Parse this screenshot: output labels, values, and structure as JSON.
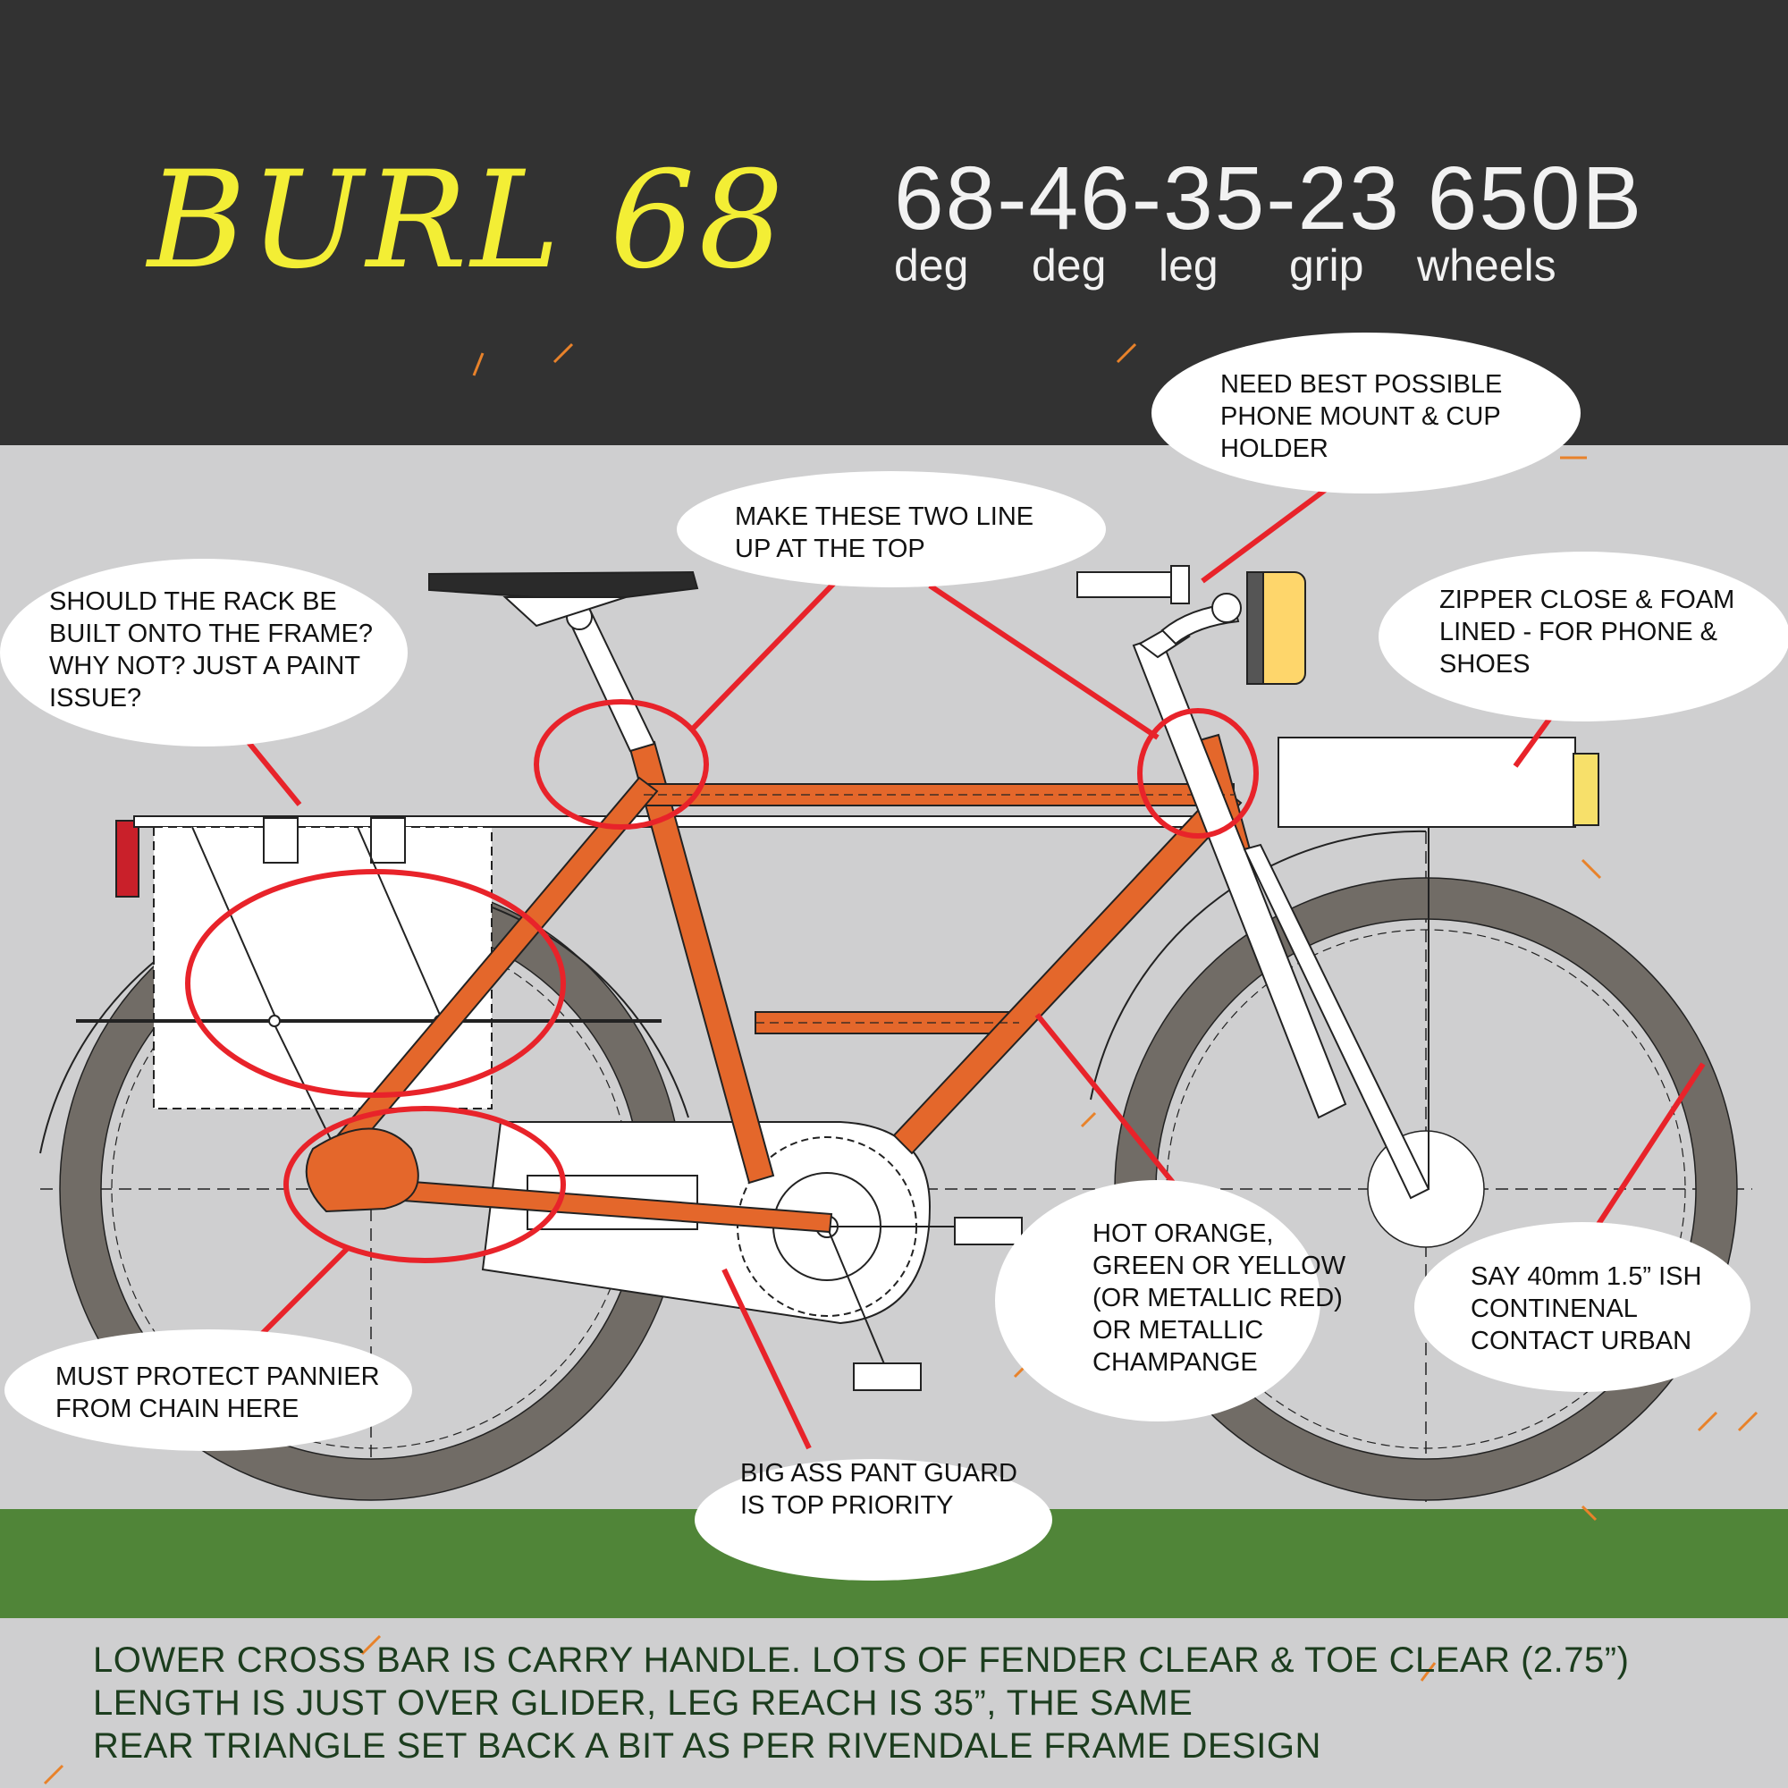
{
  "header": {
    "title": "BURL 68",
    "spec": "68-46-35-23 650B",
    "spec_labels": [
      "deg",
      "deg",
      "leg",
      "grip",
      "wheels"
    ]
  },
  "callouts": {
    "phone_mount": "NEED BEST POSSIBLE\nPHONE MOUNT & CUP\nHOLDER",
    "line_up": "MAKE THESE TWO LINE\nUP AT THE TOP",
    "rack": "SHOULD THE RACK BE\nBUILT ONTO THE FRAME?\nWHY NOT? JUST A PAINT\nISSUE?",
    "zipper": "ZIPPER CLOSE & FOAM\nLINED - FOR PHONE &\nSHOES",
    "pannier": "MUST PROTECT PANNIER\nFROM CHAIN HERE",
    "pant_guard": "BIG ASS PANT GUARD\nIS TOP PRIORITY",
    "color": "HOT ORANGE,\nGREEN OR YELLOW\n(OR METALLIC RED)\nOR METALLIC\nCHAMPANGE",
    "tire": "SAY 40mm 1.5” ISH\nCONTINENAL\nCONTACT URBAN"
  },
  "notes": [
    "LOWER CROSS BAR IS CARRY HANDLE. LOTS OF FENDER CLEAR & TOE CLEAR (2.75”)",
    "LENGTH IS JUST OVER GLIDER, LEG REACH IS 35”, THE SAME",
    "REAR TRIANGLE SET BACK A BIT AS PER RIVENDALE FRAME DESIGN"
  ],
  "colors": {
    "frame": "#e4672b",
    "highlight": "#e8232a",
    "header_bg": "#323232",
    "title": "#f3ee35",
    "ground": "#508538",
    "tire": "#716c66",
    "notes_text": "#1c3d1e"
  }
}
